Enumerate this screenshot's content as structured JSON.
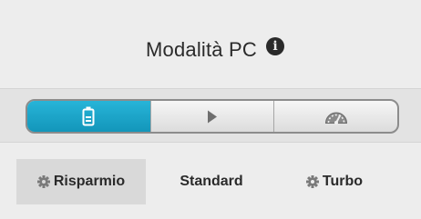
{
  "header": {
    "title": "Modalità PC",
    "info_icon": "info-icon",
    "info_glyph": "i"
  },
  "mode_bar": {
    "selected": "risparmio",
    "accent_color": "#1aa6cc",
    "segments": [
      {
        "id": "risparmio",
        "icon": "battery-icon"
      },
      {
        "id": "standard",
        "icon": "play-icon"
      },
      {
        "id": "turbo",
        "icon": "gauge-icon"
      }
    ]
  },
  "modes": [
    {
      "id": "risparmio",
      "label": "Risparmio",
      "icon": "gear-icon"
    },
    {
      "id": "standard",
      "label": "Standard"
    },
    {
      "id": "turbo",
      "label": "Turbo",
      "icon": "gear-icon"
    }
  ]
}
